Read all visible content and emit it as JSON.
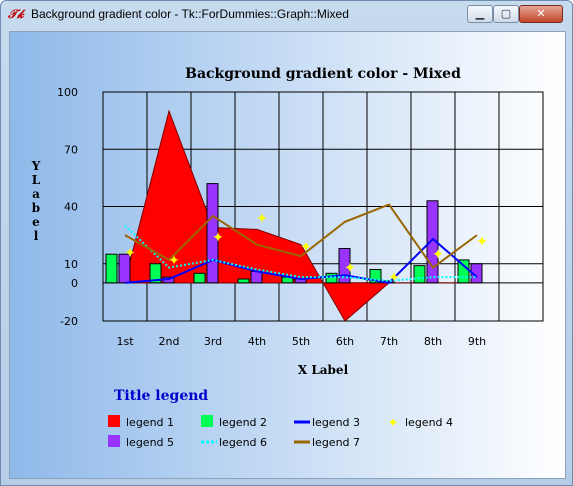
{
  "window": {
    "title": "Background gradient color - Tk::ForDummies::Graph::Mixed",
    "icon": "tk-feather-icon",
    "controls": {
      "minimize": "minimize-icon",
      "maximize": "maximize-icon",
      "close": "close-icon"
    }
  },
  "chart_data": {
    "type": "mixed",
    "title": "Background gradient color - Mixed",
    "xlabel": "X Label",
    "ylabel": "Y Label",
    "ylim": [
      -20,
      100
    ],
    "yticks": [
      "100",
      "70",
      "40",
      "10",
      "0",
      "-20"
    ],
    "grid": true,
    "categories": [
      "1st",
      "2nd",
      "3rd",
      "4th",
      "5th",
      "6th",
      "7th",
      "8th",
      "9th"
    ],
    "background_gradient": [
      "#8fb9ea",
      "#ffffff"
    ],
    "legend": {
      "title": "Title legend",
      "position": "bottom"
    },
    "series": [
      {
        "name": "legend 1",
        "style": "area",
        "color": "#ff0000",
        "values": [
          1,
          90,
          29,
          28,
          20,
          -20,
          0,
          0,
          0
        ]
      },
      {
        "name": "legend 2",
        "style": "bar",
        "color": "#00ff55",
        "values": [
          15,
          10,
          5,
          2,
          3,
          5,
          7,
          9,
          12
        ]
      },
      {
        "name": "legend 3",
        "style": "line",
        "color": "#0000ff",
        "values": [
          0,
          2,
          12,
          6,
          2,
          4,
          0,
          23,
          3
        ]
      },
      {
        "name": "legend 4",
        "style": "point",
        "color": "#ffff00",
        "values": [
          16,
          12,
          24,
          34,
          19,
          8,
          3,
          15,
          22
        ]
      },
      {
        "name": "legend 5",
        "style": "bar",
        "color": "#9933ff",
        "values": [
          15,
          3,
          52,
          6,
          2,
          18,
          1,
          43,
          10
        ]
      },
      {
        "name": "legend 6",
        "style": "dashed",
        "color": "#00ffff",
        "values": [
          30,
          8,
          12,
          7,
          3,
          3,
          1,
          3,
          3
        ]
      },
      {
        "name": "legend 7",
        "style": "line",
        "color": "#996600",
        "values": [
          25,
          12,
          35,
          20,
          14,
          32,
          41,
          8,
          25
        ]
      }
    ]
  }
}
